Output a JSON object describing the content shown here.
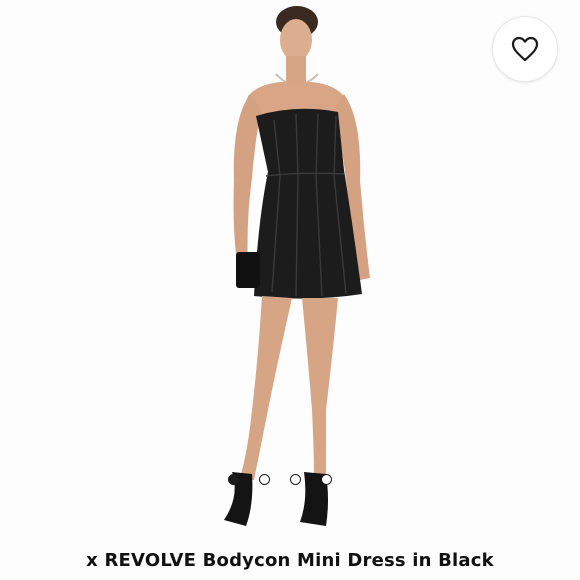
{
  "product": {
    "title": "x REVOLVE Bodycon Mini Dress in Black",
    "image_alt": "model wearing strapless black leather mini dress"
  },
  "carousel": {
    "slide_count": 4,
    "active_index": 0
  },
  "favorite": {
    "icon": "heart-icon",
    "label": "Favorite"
  },
  "colors": {
    "background": "#fdfdfd",
    "dress": "#1c1c1c",
    "skin": "#d9a98a",
    "text": "#111111"
  }
}
